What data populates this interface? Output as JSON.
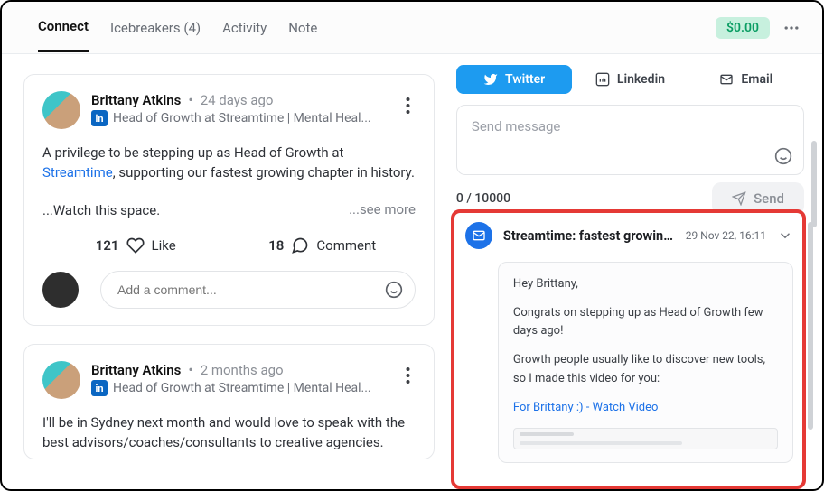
{
  "topbar": {
    "tabs": [
      {
        "label": "Connect",
        "active": true
      },
      {
        "label": "Icebreakers (4)",
        "active": false
      },
      {
        "label": "Activity",
        "active": false
      },
      {
        "label": "Note",
        "active": false
      }
    ],
    "badge": "$0.00"
  },
  "feed": [
    {
      "author": "Brittany Atkins",
      "age": "24 days ago",
      "role": "Head of Growth at Streamtime | Mental Heal...",
      "body_pre": "A privilege to be stepping up as Head of Growth at ",
      "body_link": "Streamtime",
      "body_post": ", supporting our fastest growing chapter in history.",
      "body_line2": "...Watch this space.",
      "see_more": "...see more",
      "likes": "121",
      "like_label": "Like",
      "comments": "18",
      "comment_label": "Comment",
      "add_comment_placeholder": "Add a comment..."
    },
    {
      "author": "Brittany Atkins",
      "age": "2 months ago",
      "role": "Head of Growth at Streamtime | Mental Heal...",
      "body": "I'll be in Sydney next month and would love to speak with the best advisors/coaches/consultants to creative agencies."
    }
  ],
  "channels": {
    "twitter": "Twitter",
    "linkedin": "Linkedin",
    "email": "Email"
  },
  "composer": {
    "placeholder": "Send message",
    "counter": "0 / 10000",
    "send_label": "Send"
  },
  "email_thread": {
    "subject": "Streamtime: fastest growin...",
    "date": "29 Nov 22, 16:11",
    "greeting": "Hey Brittany,",
    "p1": "Congrats on stepping up as Head of Growth few days ago!",
    "p2": "Growth people usually like to discover new tools, so I made this video for you:",
    "video_link": "For Brittany :) - Watch Video"
  }
}
